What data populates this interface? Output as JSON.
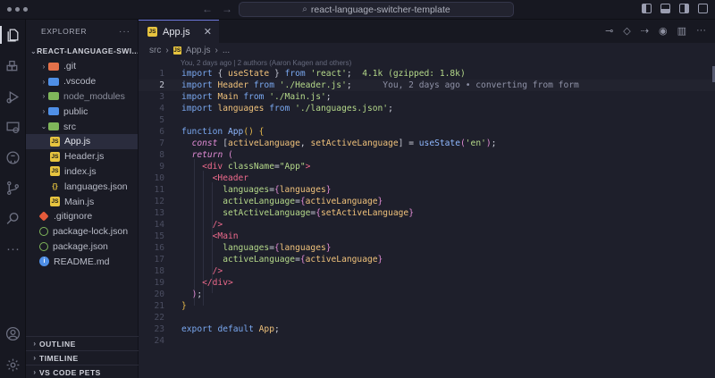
{
  "window": {
    "search_text": "react-language-switcher-template"
  },
  "explorer": {
    "title": "EXPLORER",
    "root": "REACT-LANGUAGE-SWI...",
    "items": [
      {
        "label": ".git",
        "kind": "folder",
        "color": "#e4714a",
        "depth": 1,
        "chev": "›"
      },
      {
        "label": ".vscode",
        "kind": "folder",
        "color": "#4f8fe6",
        "depth": 1,
        "chev": "›"
      },
      {
        "label": "node_modules",
        "kind": "folder",
        "color": "#7fb65a",
        "depth": 1,
        "chev": "›"
      },
      {
        "label": "public",
        "kind": "folder",
        "color": "#4f8fe6",
        "depth": 1,
        "chev": "›"
      },
      {
        "label": "src",
        "kind": "folder",
        "color": "#7fb65a",
        "depth": 1,
        "chev": "⌄"
      },
      {
        "label": "App.js",
        "kind": "js",
        "depth": 2,
        "selected": true
      },
      {
        "label": "Header.js",
        "kind": "js",
        "depth": 2
      },
      {
        "label": "index.js",
        "kind": "js",
        "depth": 2
      },
      {
        "label": "languages.json",
        "kind": "json",
        "depth": 2
      },
      {
        "label": "Main.js",
        "kind": "js",
        "depth": 2
      },
      {
        "label": ".gitignore",
        "kind": "git",
        "depth": 1
      },
      {
        "label": "package-lock.json",
        "kind": "npm",
        "depth": 1
      },
      {
        "label": "package.json",
        "kind": "npm",
        "depth": 1
      },
      {
        "label": "README.md",
        "kind": "info",
        "depth": 1
      }
    ],
    "panels": [
      "OUTLINE",
      "TIMELINE",
      "VS CODE PETS"
    ]
  },
  "editor": {
    "tab_label": "App.js",
    "breadcrumb": [
      "src",
      "App.js",
      "..."
    ],
    "blame_header": "You, 2 days ago | 2 authors (Aaron Kagen and others)",
    "current_line": 2,
    "line_count": 24
  },
  "colors": {
    "accent": "#6f7ae0",
    "js_icon": "#e7c43f"
  }
}
